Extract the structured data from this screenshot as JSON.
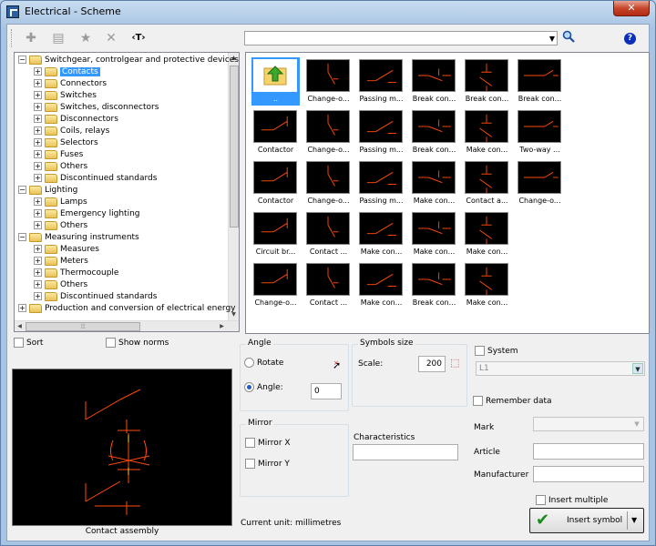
{
  "window": {
    "title": "Electrical - Scheme",
    "close": "✕"
  },
  "toolbar": {
    "text_tool": "‹T›"
  },
  "search": {
    "value": ""
  },
  "tree": {
    "items": [
      {
        "label": "Switchgear, controlgear and protective devices",
        "level": 0,
        "sign": "−"
      },
      {
        "label": "Contacts",
        "level": 1,
        "sign": "+",
        "selected": true
      },
      {
        "label": "Connectors",
        "level": 1,
        "sign": "+"
      },
      {
        "label": "Switches",
        "level": 1,
        "sign": "+"
      },
      {
        "label": "Switches, disconnectors",
        "level": 1,
        "sign": "+"
      },
      {
        "label": "Disconnectors",
        "level": 1,
        "sign": "+"
      },
      {
        "label": "Coils, relays",
        "level": 1,
        "sign": "+"
      },
      {
        "label": "Selectors",
        "level": 1,
        "sign": "+"
      },
      {
        "label": "Fuses",
        "level": 1,
        "sign": "+"
      },
      {
        "label": "Others",
        "level": 1,
        "sign": "+"
      },
      {
        "label": "Discontinued standards",
        "level": 1,
        "sign": "+"
      },
      {
        "label": "Lighting",
        "level": 0,
        "sign": "−"
      },
      {
        "label": "Lamps",
        "level": 1,
        "sign": "+"
      },
      {
        "label": "Emergency lighting",
        "level": 1,
        "sign": "+"
      },
      {
        "label": "Others",
        "level": 1,
        "sign": "+"
      },
      {
        "label": "Measuring instruments",
        "level": 0,
        "sign": "−"
      },
      {
        "label": "Measures",
        "level": 1,
        "sign": "+"
      },
      {
        "label": "Meters",
        "level": 1,
        "sign": "+"
      },
      {
        "label": "Thermocouple",
        "level": 1,
        "sign": "+"
      },
      {
        "label": "Others",
        "level": 1,
        "sign": "+"
      },
      {
        "label": "Discontinued standards",
        "level": 1,
        "sign": "+"
      },
      {
        "label": "Production and conversion of electrical energy",
        "level": 0,
        "sign": "+"
      }
    ]
  },
  "gallery": {
    "rows": [
      [
        "..",
        "Change-o...",
        "Passing m...",
        "Break con...",
        "Break con...",
        "Break con..."
      ],
      [
        "Contactor",
        "Change-o...",
        "Passing m...",
        "Break con...",
        "Make con...",
        "Two-way ..."
      ],
      [
        "Contactor",
        "Change-o...",
        "Passing m...",
        "Make con...",
        "Contact a...",
        "Change-o..."
      ],
      [
        "Circuit br...",
        "Contact ...",
        "Make con...",
        "Make con...",
        "Make con..."
      ],
      [
        "Change-o...",
        "Contact ...",
        "Make con...",
        "Break con...",
        "Make con..."
      ]
    ]
  },
  "options": {
    "sort": "Sort",
    "show_norms": "Show norms",
    "preview_caption": "Contact assembly",
    "angle_title": "Angle",
    "rotate": "Rotate",
    "angle_label": "Angle:",
    "angle_value": "0",
    "size_title": "Symbols size",
    "scale_label": "Scale:",
    "scale_value": "200",
    "mirror_title": "Mirror",
    "mirror_x": "Mirror X",
    "mirror_y": "Mirror Y",
    "characteristics": "Characteristics",
    "current_unit": "Current unit: millimetres",
    "system": "System",
    "system_value": "L1",
    "remember": "Remember data",
    "mark": "Mark",
    "article": "Article",
    "manufacturer": "Manufacturer",
    "insert_multiple": "Insert multiple",
    "insert_symbol": "Insert symbol"
  },
  "colors": {
    "symbol": "#ff4a0a",
    "symbol_accent": "#e8d24a"
  }
}
